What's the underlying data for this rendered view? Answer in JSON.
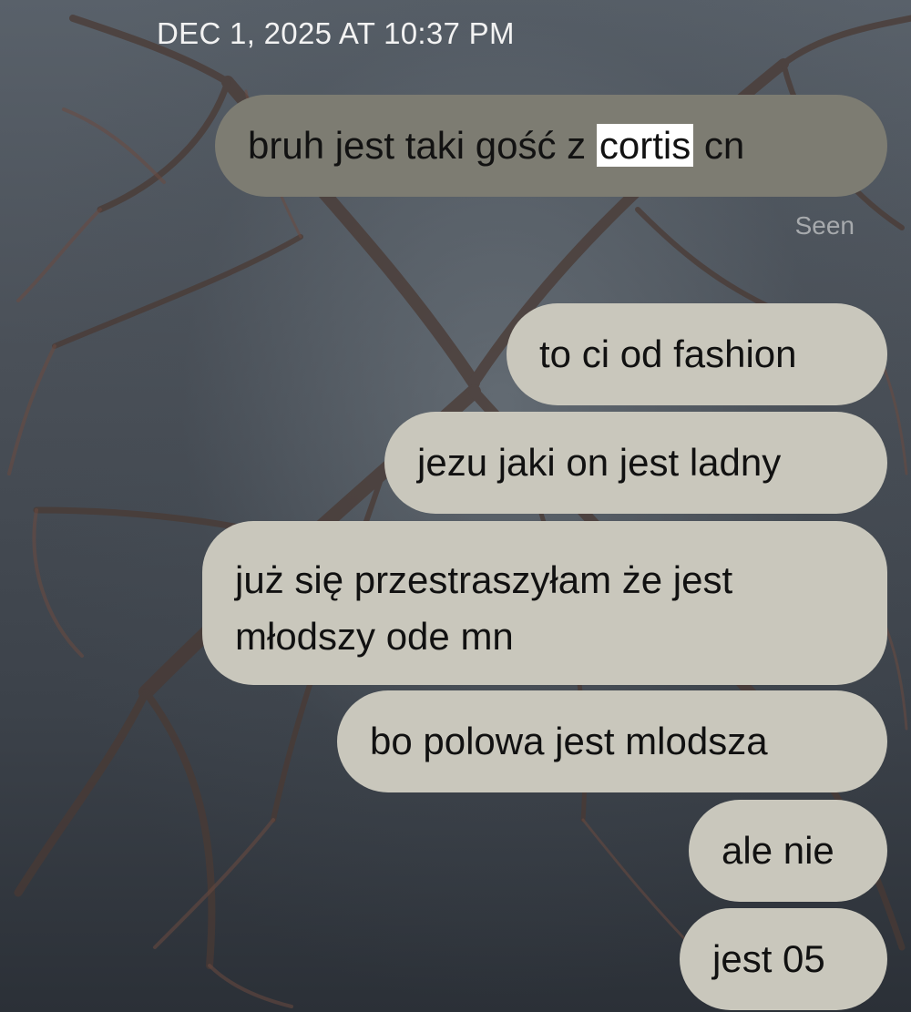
{
  "header": {
    "timestamp": "DEC 1, 2025 AT 10:37 PM"
  },
  "messages": [
    {
      "style": "gray",
      "text_before": "bruh jest taki gość z ",
      "highlighted": "cortis",
      "text_after": " cn"
    },
    {
      "style": "light",
      "text": "to ci od fashion"
    },
    {
      "style": "light",
      "text": "jezu jaki on jest ladny"
    },
    {
      "style": "light",
      "line1": "już się przestraszyłam że jest",
      "line2": "młodszy ode mn"
    },
    {
      "style": "light",
      "text": "bo polowa jest mlodsza"
    },
    {
      "style": "light",
      "text": "ale nie"
    },
    {
      "style": "light",
      "text": "jest 05"
    }
  ],
  "status": {
    "seen": "Seen"
  },
  "colors": {
    "sent_bubble_dark": "#7d7c72",
    "sent_bubble_light": "#c9c7bc",
    "timestamp_text": "#f2f2f2",
    "seen_text": "#a7aaad"
  }
}
